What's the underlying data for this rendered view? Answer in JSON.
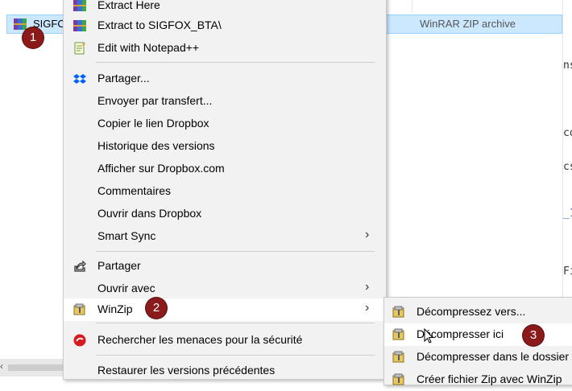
{
  "explorer": {
    "file_name": "SIGFOX",
    "file_type": "WinRAR ZIP archive",
    "right_fragments": [
      "ns",
      "co",
      "cs",
      "_1",
      "Fi"
    ],
    "scroll_arrow": "‹"
  },
  "context_menu": {
    "items": [
      {
        "label": "Extract Here",
        "icon": "winrar-icon"
      },
      {
        "label": "Extract to SIGFOX_BTA\\",
        "icon": "winrar-icon"
      },
      {
        "label": "Edit with Notepad++",
        "icon": "notepad-icon"
      },
      {
        "label": "Partager...",
        "icon": "dropbox-icon"
      },
      {
        "label": "Envoyer par transfert..."
      },
      {
        "label": "Copier le lien Dropbox"
      },
      {
        "label": "Historique des versions"
      },
      {
        "label": "Afficher sur Dropbox.com"
      },
      {
        "label": "Commentaires"
      },
      {
        "label": "Ouvrir dans Dropbox"
      },
      {
        "label": "Smart Sync",
        "has_submenu": true
      },
      {
        "label": "Partager",
        "icon": "share-icon"
      },
      {
        "label": "Ouvrir avec",
        "has_submenu": true
      },
      {
        "label": "WinZip",
        "icon": "winzip-icon",
        "has_submenu": true,
        "highlighted": true
      },
      {
        "label": "Rechercher les menaces pour la sécurité",
        "icon": "trend-micro-icon"
      },
      {
        "label": "Restaurer les versions précédentes"
      }
    ],
    "chevron": "›"
  },
  "winzip_submenu": {
    "items": [
      {
        "label": "Décompressez vers...",
        "icon": "winzip-icon"
      },
      {
        "label": "Décompresser ici",
        "icon": "winzip-icon",
        "highlighted": true
      },
      {
        "label": "Décompresser dans le dossier",
        "icon": "winzip-icon"
      },
      {
        "label": "Créer fichier Zip avec WinZip",
        "icon": "winzip-icon"
      }
    ]
  },
  "badges": [
    "1",
    "2",
    "3"
  ],
  "colors": {
    "selection": "#cce8ff",
    "menu_bg": "#f2f2f2",
    "highlight": "#ffffff",
    "badge": "#8b1a1a"
  }
}
